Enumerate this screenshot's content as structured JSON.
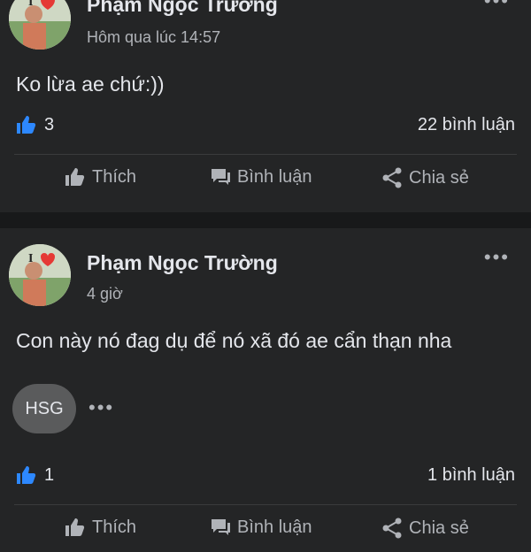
{
  "posts": [
    {
      "author": "Phạm Ngọc Trường",
      "time": "Hôm qua lúc 14:57",
      "text": "Ko lừa ae chứ:))",
      "likes": "3",
      "comments": "22 bình luận",
      "actions": {
        "like": "Thích",
        "comment": "Bình luận",
        "share": "Chia sẻ"
      }
    },
    {
      "author": "Phạm Ngọc Trường",
      "time": "4 giờ",
      "text": "Con này nó đag dụ để nó xã đó ae cẩn thạn nha",
      "tag": "HSG",
      "tag_more": "•••",
      "likes": "1",
      "comments": "1 bình luận",
      "actions": {
        "like": "Thích",
        "comment": "Bình luận",
        "share": "Chia sẻ"
      }
    }
  ],
  "more_glyph": "•••",
  "colors": {
    "background": "#242526",
    "separator": "#18191a",
    "like_blue": "#2d88ff",
    "text": "#e4e6eb",
    "muted": "#b0b3b8"
  }
}
